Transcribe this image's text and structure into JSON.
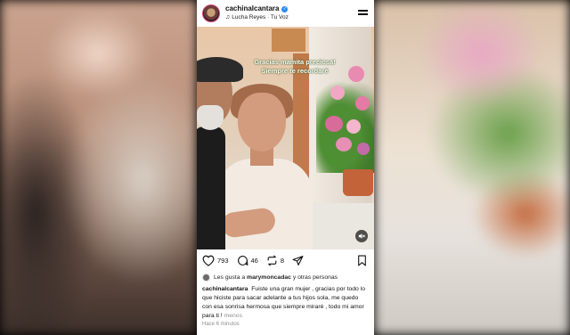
{
  "header": {
    "username": "cachinalcantara",
    "music": "Lucha Reyes · Tu Voz"
  },
  "photo": {
    "overlay_line1": "Gracias mamita preciosa!",
    "overlay_line2": "Siempre te recordaré"
  },
  "actions": {
    "likes_count": "793",
    "comments_count": "46",
    "reposts_count": "8"
  },
  "likes_line": {
    "prefix": "Les gusta a",
    "user": "marymoncadac",
    "suffix": "y otras personas"
  },
  "caption": {
    "username": "cachinalcantara",
    "text": "Fuiste una gran mujer , gracias por todo lo que hiciste para sacar adelante a tus hijos sola, me quedo con esa sonrisa hermosa que siempre miraré , todo mi amor para ti !",
    "more": "menos"
  },
  "timestamp": "Hace 6 minutos",
  "colors": {
    "verified": "#2b8cf5",
    "avatar_ring": "#d94b7a"
  },
  "icons": [
    "heart-icon",
    "comment-icon",
    "repost-icon",
    "share-icon",
    "bookmark-icon",
    "menu-icon",
    "music-note-icon",
    "mute-icon",
    "verified-icon"
  ]
}
